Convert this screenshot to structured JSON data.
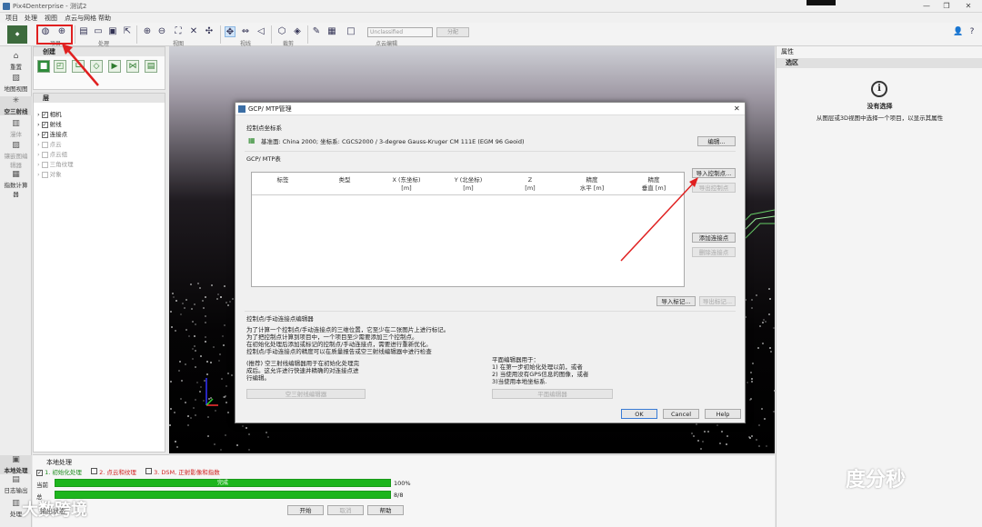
{
  "window": {
    "title": "Pix4Denterprise - 测试2",
    "min": "—",
    "max": "❐",
    "close": "✕"
  },
  "menu": [
    "项目",
    "处理",
    "视图",
    "点云与网格",
    "帮助"
  ],
  "toolbar": {
    "groups": [
      "项目",
      "处理",
      "视图",
      "视线",
      "裁剪",
      "点云编辑"
    ],
    "classification": "Unclassified",
    "assign": "分配"
  },
  "nav": [
    "重置",
    "地图视图",
    "空三射线",
    "漫体",
    "镶嵌图编辑器",
    "指数计算器"
  ],
  "create": {
    "title": "创建"
  },
  "layers": {
    "title": "层",
    "items": [
      {
        "label": "相机",
        "checked": true
      },
      {
        "label": "射线",
        "checked": true
      },
      {
        "label": "连接点",
        "checked": true
      },
      {
        "label": "点云",
        "checked": false
      },
      {
        "label": "点云组",
        "checked": false
      },
      {
        "label": "三角纹理",
        "checked": false
      },
      {
        "label": "对象",
        "checked": false
      }
    ]
  },
  "properties": {
    "title": "属性",
    "section": "选区",
    "none_title": "没有选择",
    "none_desc": "从图层或3D视图中选择一个项目，以显示其属性"
  },
  "dialog": {
    "title": "GCP/ MTP管理",
    "crs_label": "控制点坐标系",
    "crs_text": "基准面: China 2000; 坐标系: CGCS2000 / 3-degree Gauss-Kruger CM 111E (EGM 96 Geoid)",
    "edit": "编辑...",
    "table_label": "GCP/ MTP表",
    "columns": [
      {
        "a": "标签",
        "b": ""
      },
      {
        "a": "类型",
        "b": ""
      },
      {
        "a": "X (东坐标)",
        "b": "[m]"
      },
      {
        "a": "Y (北坐标)",
        "b": "[m]"
      },
      {
        "a": "Z",
        "b": "[m]"
      },
      {
        "a": "精度",
        "b": "水平 [m]"
      },
      {
        "a": "精度",
        "b": "垂直 [m]"
      }
    ],
    "import_gcp": "导入控制点...",
    "export_gcp": "导出控制点",
    "add_tie": "添加连接点",
    "remove_tie": "删除连接点",
    "import_marks": "导入标记...",
    "export_marks": "导出标记...",
    "editor_label": "控制点/手动连接点编辑器",
    "desc1": [
      "为了计算一个控制点/手动连接点的三维位置，它至少在二张图片上进行标记。",
      "为了把控制点计算到项目中，一个项目至少需要添加三个控制点。",
      "在初始化处理后添加或标记的控制点/手动连接点，需要进行重新优化。",
      "控制点/手动连接点的精度可以在质量报告或空三射线编辑器中进行检查"
    ],
    "desc2": [
      "(推荐) 空三射线编辑器用于在初始化处理完",
      "成后。这允许进行快速并精确的对连接点进",
      "行编辑。"
    ],
    "desc3": [
      "平面编辑器用于：",
      "1) 在第一步初始化处理以前，或者",
      "2) 当使用没有GPS信息的图像，或者",
      "3)当使用本地坐标系."
    ],
    "ray_editor": "空三射线编辑器",
    "plane_editor": "平面编辑器",
    "ok": "OK",
    "cancel": "Cancel",
    "help": "Help"
  },
  "processing": {
    "title": "本地处理",
    "steps": [
      {
        "label": "1. 初始化处理",
        "checked": true,
        "color": "#1a8a1a"
      },
      {
        "label": "2. 点云和纹理",
        "checked": false,
        "color": "#d02020"
      },
      {
        "label": "3. DSM, 正射影像和指数",
        "checked": false,
        "color": "#d02020"
      }
    ],
    "current_label": "当前",
    "current_text": "完成",
    "current_value": "100%",
    "current_progress": 1.0,
    "total_label": "总",
    "total_value": "8/8",
    "total_progress": 1.0,
    "start": "开始",
    "cancel": "取消",
    "help": "帮助"
  },
  "bottom_nav": [
    "本地处理",
    "日志输出",
    "处理"
  ],
  "watermarks": {
    "right": "度分秒",
    "left": "大数跨境",
    "bottom": "输出状态"
  }
}
